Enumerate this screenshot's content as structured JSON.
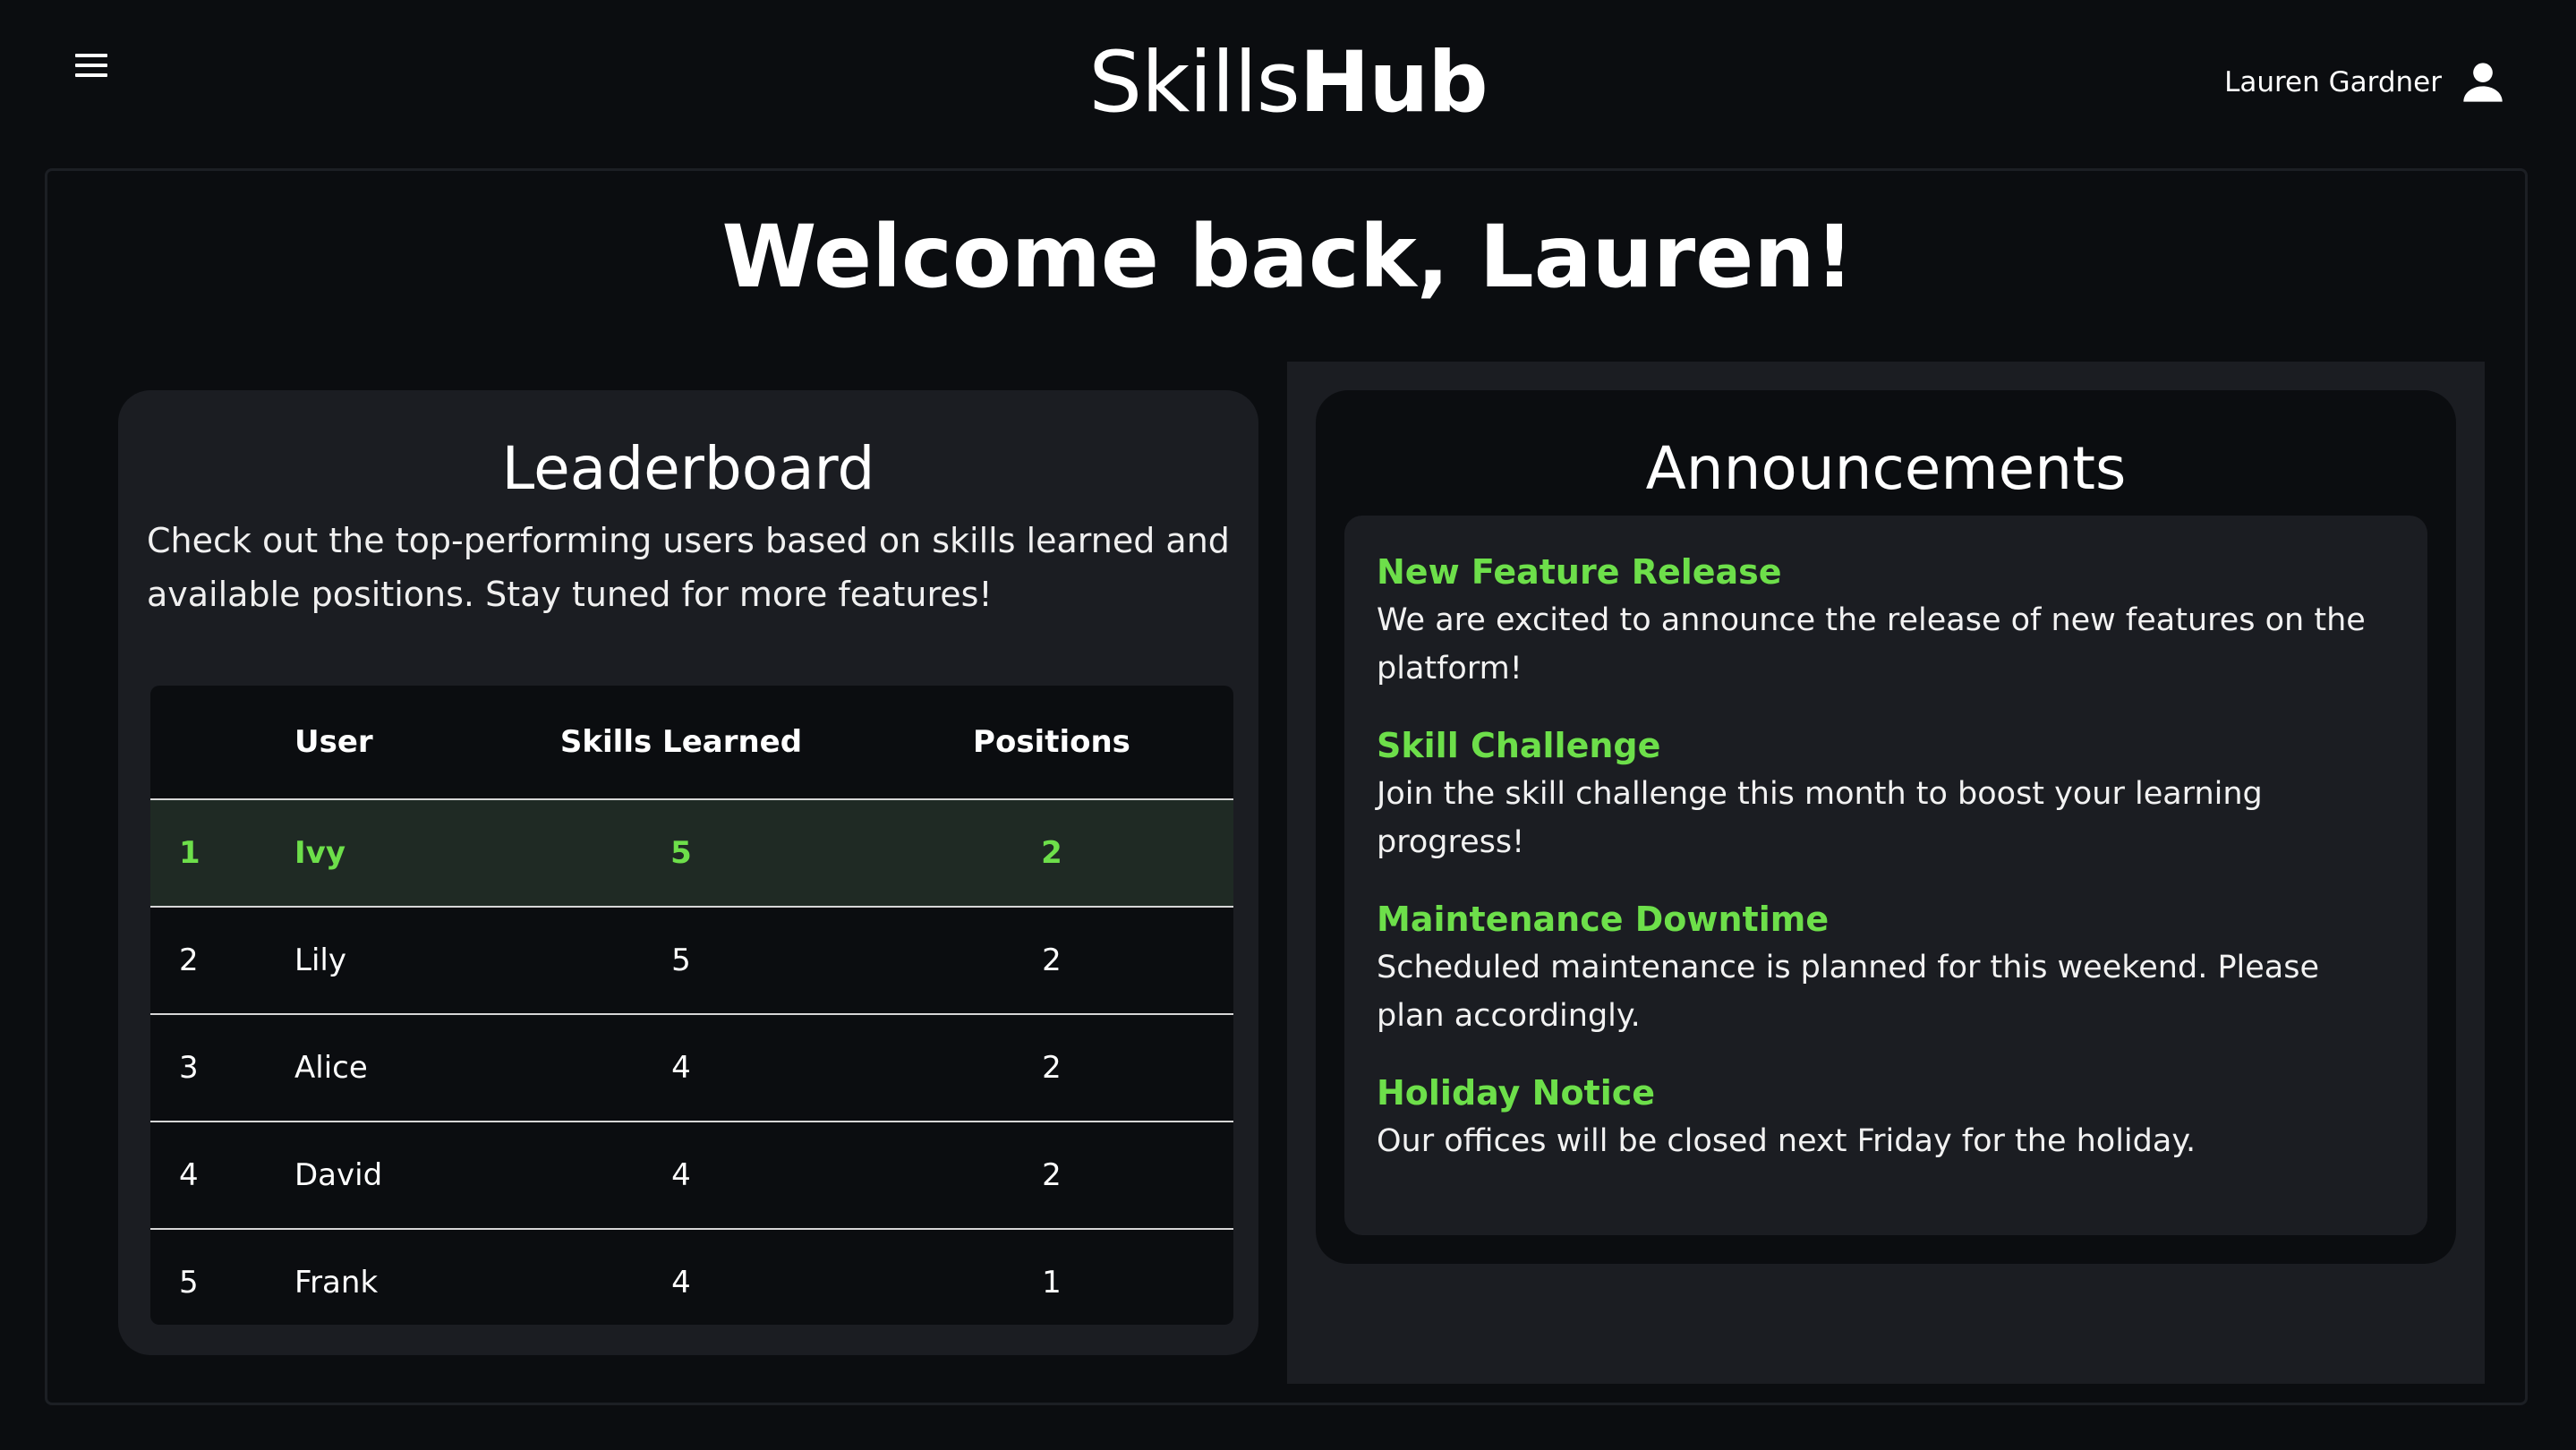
{
  "header": {
    "brand_light": "Skills",
    "brand_bold": "Hub",
    "user_name": "Lauren Gardner",
    "menu_icon": "hamburger-menu-icon",
    "user_icon": "person-icon"
  },
  "welcome": "Welcome back, Lauren!",
  "leaderboard": {
    "title": "Leaderboard",
    "description": "Check out the top-performing users based on skills learned and available positions. Stay tuned for more features!",
    "columns": [
      "",
      "User",
      "Skills Learned",
      "Positions"
    ],
    "rows": [
      {
        "rank": "1",
        "user": "Ivy",
        "skills": "5",
        "positions": "2"
      },
      {
        "rank": "2",
        "user": "Lily",
        "skills": "5",
        "positions": "2"
      },
      {
        "rank": "3",
        "user": "Alice",
        "skills": "4",
        "positions": "2"
      },
      {
        "rank": "4",
        "user": "David",
        "skills": "4",
        "positions": "2"
      },
      {
        "rank": "5",
        "user": "Frank",
        "skills": "4",
        "positions": "1"
      }
    ]
  },
  "announcements": {
    "title": "Announcements",
    "items": [
      {
        "title": "New Feature Release",
        "body": "We are excited to announce the release of new features on the platform!"
      },
      {
        "title": "Skill Challenge",
        "body": "Join the skill challenge this month to boost your learning progress!"
      },
      {
        "title": "Maintenance Downtime",
        "body": "Scheduled maintenance is planned for this weekend. Please plan accordingly."
      },
      {
        "title": "Holiday Notice",
        "body": "Our offices will be closed next Friday for the holiday."
      }
    ]
  },
  "colors": {
    "accent": "#6ddf4a",
    "background": "#0b0d10",
    "card": "#1b1d22",
    "highlight_row": "#1f2a24"
  }
}
